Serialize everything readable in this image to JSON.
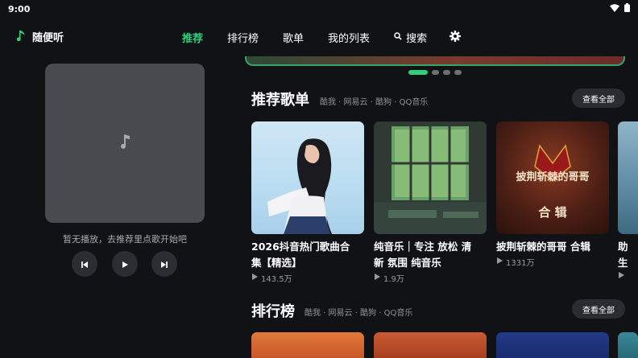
{
  "status": {
    "time": "9:00"
  },
  "brand": {
    "name": "随便听",
    "icon": "music-note-icon"
  },
  "nav": {
    "recommend": "推荐",
    "charts": "排行榜",
    "playlists": "歌单",
    "my_list": "我的列表",
    "search": "搜索"
  },
  "player": {
    "idle_text": "暂无播放，去推荐里点歌开始吧"
  },
  "sections": {
    "recommended": {
      "title": "推荐歌单",
      "sources": "酷我 · 网易云 · 酷狗 · QQ音乐",
      "view_all": "查看全部"
    },
    "ranking": {
      "title": "排行榜",
      "sources": "酷我 · 网易云 · 酷狗 · QQ音乐",
      "view_all": "查看全部"
    }
  },
  "playlists": [
    {
      "line1": "2026抖音热门歌曲合",
      "line2": "集【精选】",
      "plays": "143.5万"
    },
    {
      "line1": "纯音乐｜专注 放松 清",
      "line2": "新 氛围 纯音乐",
      "plays": "1.9万"
    },
    {
      "line1": "披荆斩棘的哥哥 合辑",
      "line2": "",
      "plays": "1331万",
      "art_title": "披荆斩棘的哥哥",
      "art_sub": "合 辑"
    },
    {
      "line1": "助",
      "line2": "生",
      "plays": ""
    }
  ],
  "carousel": {
    "count": 4,
    "active": 0
  },
  "colors": {
    "accent": "#2fd07b",
    "background": "#111216"
  }
}
